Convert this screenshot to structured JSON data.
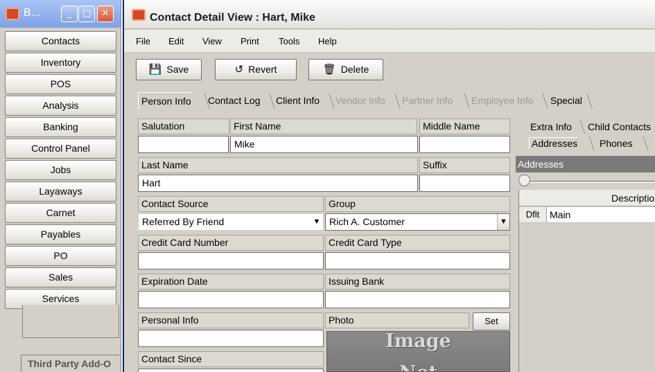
{
  "launcher": {
    "title": "B...",
    "min_label": "_",
    "max_label": "□",
    "close_label": "✕",
    "nav_items": [
      "Contacts",
      "Inventory",
      "POS",
      "Analysis",
      "Banking",
      "Control Panel",
      "Jobs",
      "Layaways",
      "Carnet",
      "Payables",
      "PO",
      "Sales",
      "Services"
    ],
    "addon_label": "Third Party Add-O"
  },
  "window": {
    "title": "Contact Detail View : Hart, Mike"
  },
  "menu": [
    "File",
    "Edit",
    "View",
    "Print",
    "Tools",
    "Help"
  ],
  "toolbar": {
    "save_label": "Save",
    "revert_label": "Revert",
    "delete_label": "Delete"
  },
  "tabs": [
    {
      "label": "Person Info",
      "state": "active"
    },
    {
      "label": "Contact Log",
      "state": "enabled"
    },
    {
      "label": "Client Info",
      "state": "enabled"
    },
    {
      "label": "Vendor Info",
      "state": "disabled"
    },
    {
      "label": "Partner Info",
      "state": "disabled"
    },
    {
      "label": "Employee Info",
      "state": "disabled"
    },
    {
      "label": "Special",
      "state": "enabled"
    }
  ],
  "form": {
    "salutation_label": "Salutation",
    "salutation_value": "",
    "first_name_label": "First Name",
    "first_name_value": "Mike",
    "middle_name_label": "Middle Name",
    "middle_name_value": "",
    "last_name_label": "Last Name",
    "last_name_value": "Hart",
    "suffix_label": "Suffix",
    "suffix_value": "",
    "contact_source_label": "Contact Source",
    "contact_source_value": "Referred By Friend",
    "group_label": "Group",
    "group_value": "Rich A. Customer",
    "cc_number_label": "Credit Card Number",
    "cc_number_value": "",
    "cc_type_label": "Credit Card Type",
    "cc_type_value": "",
    "expiration_label": "Expiration Date",
    "expiration_value": "",
    "issuing_bank_label": "Issuing Bank",
    "issuing_bank_value": "",
    "personal_info_label": "Personal Info",
    "personal_info_value": "",
    "photo_label": "Photo",
    "set_label": "Set",
    "photo_text_1": "Image",
    "photo_text_2": "Not",
    "contact_since_label": "Contact Since"
  },
  "right_panel": {
    "tab_extra_info": "Extra Info",
    "tab_child_contacts": "Child Contacts",
    "tab_addresses": "Addresses",
    "tab_phones": "Phones",
    "section_title": "Addresses",
    "column_description": "Description",
    "rows": [
      {
        "default": "Dflt",
        "description": "Main"
      }
    ]
  }
}
